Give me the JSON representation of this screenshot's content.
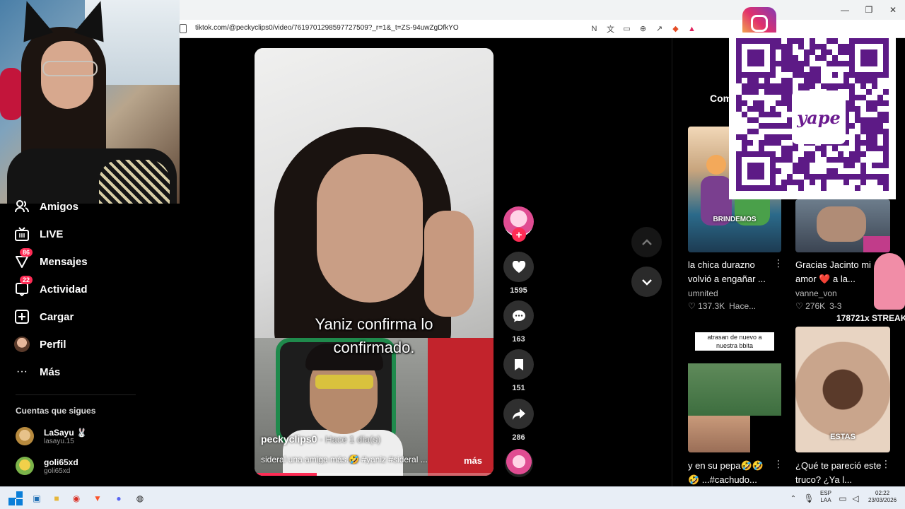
{
  "browser": {
    "url": "tiktok.com/@peckyclips0/video/7619701298597727509?_r=1&_t=ZS-94uwZgDfkYO"
  },
  "sidebar": {
    "items": [
      {
        "label": "Amigos",
        "icon": "friends-icon"
      },
      {
        "label": "LIVE",
        "icon": "live-icon"
      },
      {
        "label": "Mensajes",
        "icon": "messages-icon",
        "badge": "86"
      },
      {
        "label": "Actividad",
        "icon": "activity-icon",
        "badge": "22"
      },
      {
        "label": "Cargar",
        "icon": "upload-icon"
      },
      {
        "label": "Perfil",
        "icon": "profile-avatar"
      },
      {
        "label": "Más",
        "icon": "more-icon"
      }
    ],
    "following_title": "Cuentas que sigues",
    "following": [
      {
        "name": "LaSayu 🐰",
        "user": "lasayu.15"
      },
      {
        "name": "goli65xd",
        "user": "goli65xd"
      }
    ]
  },
  "video": {
    "caption_line1": "Yaniz confirma lo",
    "caption_line2": "confirmado.",
    "username": "peckyclips0",
    "time": "· Hace 1 día(s)",
    "description": "sideral una amiga más.🤣 #yaniz #sideral ...",
    "more": "más",
    "progress": 0.26
  },
  "actions": {
    "likes": "1595",
    "comments": "163",
    "saves": "151",
    "shares": "286"
  },
  "right_panel": {
    "comments_tab": "Com",
    "cards": [
      {
        "title": "la chica durazno volvió a engañar ...",
        "author": "umnited",
        "likes": "♡ 137.3K",
        "time": "Hace...",
        "thumb_label": "BRINDEMOS"
      },
      {
        "title": "Gracias Jacinto mi amor ❤️ a la...",
        "author": "vanne_von",
        "likes": "♡ 276K",
        "time": "3-3"
      },
      {
        "title": "y en su pepa🤣🤣 🤣 ...#cachudo...",
        "pill": "atrasan de nuevo a nuestra bbita"
      },
      {
        "title": "¿Qué te pareció este truco? ¿Ya l...",
        "thumb_label": "ESTAS"
      }
    ],
    "streak": "178721x STREAK"
  },
  "overlay": {
    "yape": "yape"
  },
  "taskbar": {
    "lang": "ESP",
    "lang2": "LAA",
    "time": "02:22",
    "date": "23/03/2026"
  }
}
